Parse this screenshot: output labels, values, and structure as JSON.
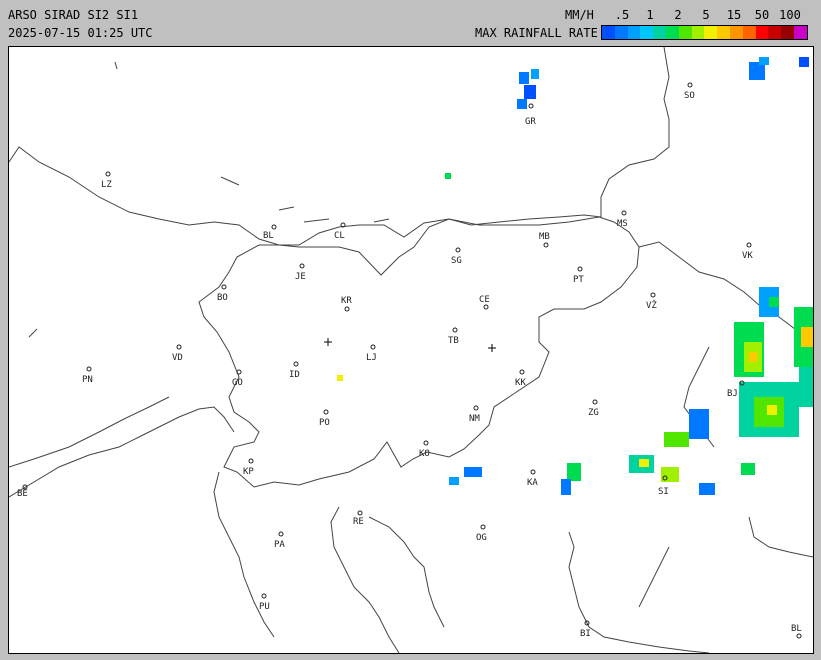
{
  "header": {
    "title": "ARSO SIRAD SI2 SI1",
    "timestamp": "2025-07-15 01:25 UTC"
  },
  "legend": {
    "unit": "MM/H",
    "title": "MAX RAINFALL RATE",
    "ticks": [
      ".5",
      "1",
      "2",
      "5",
      "15",
      "50",
      "100"
    ],
    "colors": [
      "#0050ff",
      "#0078ff",
      "#00a0ff",
      "#00c8ff",
      "#00d2a0",
      "#00dc50",
      "#50e600",
      "#a0f000",
      "#f0f000",
      "#ffc800",
      "#ff9600",
      "#ff6400",
      "#ff0000",
      "#c80000",
      "#960000",
      "#c800c8"
    ]
  },
  "map": {
    "cities": [
      {
        "id": "GR",
        "label": "GR"
      },
      {
        "id": "SO",
        "label": "SO"
      },
      {
        "id": "LZ",
        "label": "LZ"
      },
      {
        "id": "BL1",
        "label": "BL"
      },
      {
        "id": "CL",
        "label": "CL"
      },
      {
        "id": "MS",
        "label": "MS"
      },
      {
        "id": "MB",
        "label": "MB"
      },
      {
        "id": "SG",
        "label": "SG"
      },
      {
        "id": "VK",
        "label": "VK"
      },
      {
        "id": "JE",
        "label": "JE"
      },
      {
        "id": "PT",
        "label": "PT"
      },
      {
        "id": "BO",
        "label": "BO"
      },
      {
        "id": "KR",
        "label": "KR"
      },
      {
        "id": "CE",
        "label": "CE"
      },
      {
        "id": "VZ",
        "label": "VŽ"
      },
      {
        "id": "TB",
        "label": "TB"
      },
      {
        "id": "VD",
        "label": "VD"
      },
      {
        "id": "LJ",
        "label": "LJ"
      },
      {
        "id": "PN",
        "label": "PN"
      },
      {
        "id": "ID",
        "label": "ID"
      },
      {
        "id": "GO",
        "label": "GO"
      },
      {
        "id": "KK",
        "label": "KK"
      },
      {
        "id": "BJ",
        "label": "BJ"
      },
      {
        "id": "ZG",
        "label": "ZG"
      },
      {
        "id": "NM",
        "label": "NM"
      },
      {
        "id": "PO",
        "label": "PO"
      },
      {
        "id": "KO",
        "label": "KO"
      },
      {
        "id": "KP",
        "label": "KP"
      },
      {
        "id": "KA",
        "label": "KA"
      },
      {
        "id": "SI",
        "label": "SI"
      },
      {
        "id": "BE",
        "label": "BE"
      },
      {
        "id": "RE",
        "label": "RE"
      },
      {
        "id": "PA",
        "label": "PA"
      },
      {
        "id": "OG",
        "label": "OG"
      },
      {
        "id": "PU",
        "label": "PU"
      },
      {
        "id": "BI",
        "label": "BI"
      },
      {
        "id": "BL2",
        "label": "BL"
      }
    ]
  }
}
